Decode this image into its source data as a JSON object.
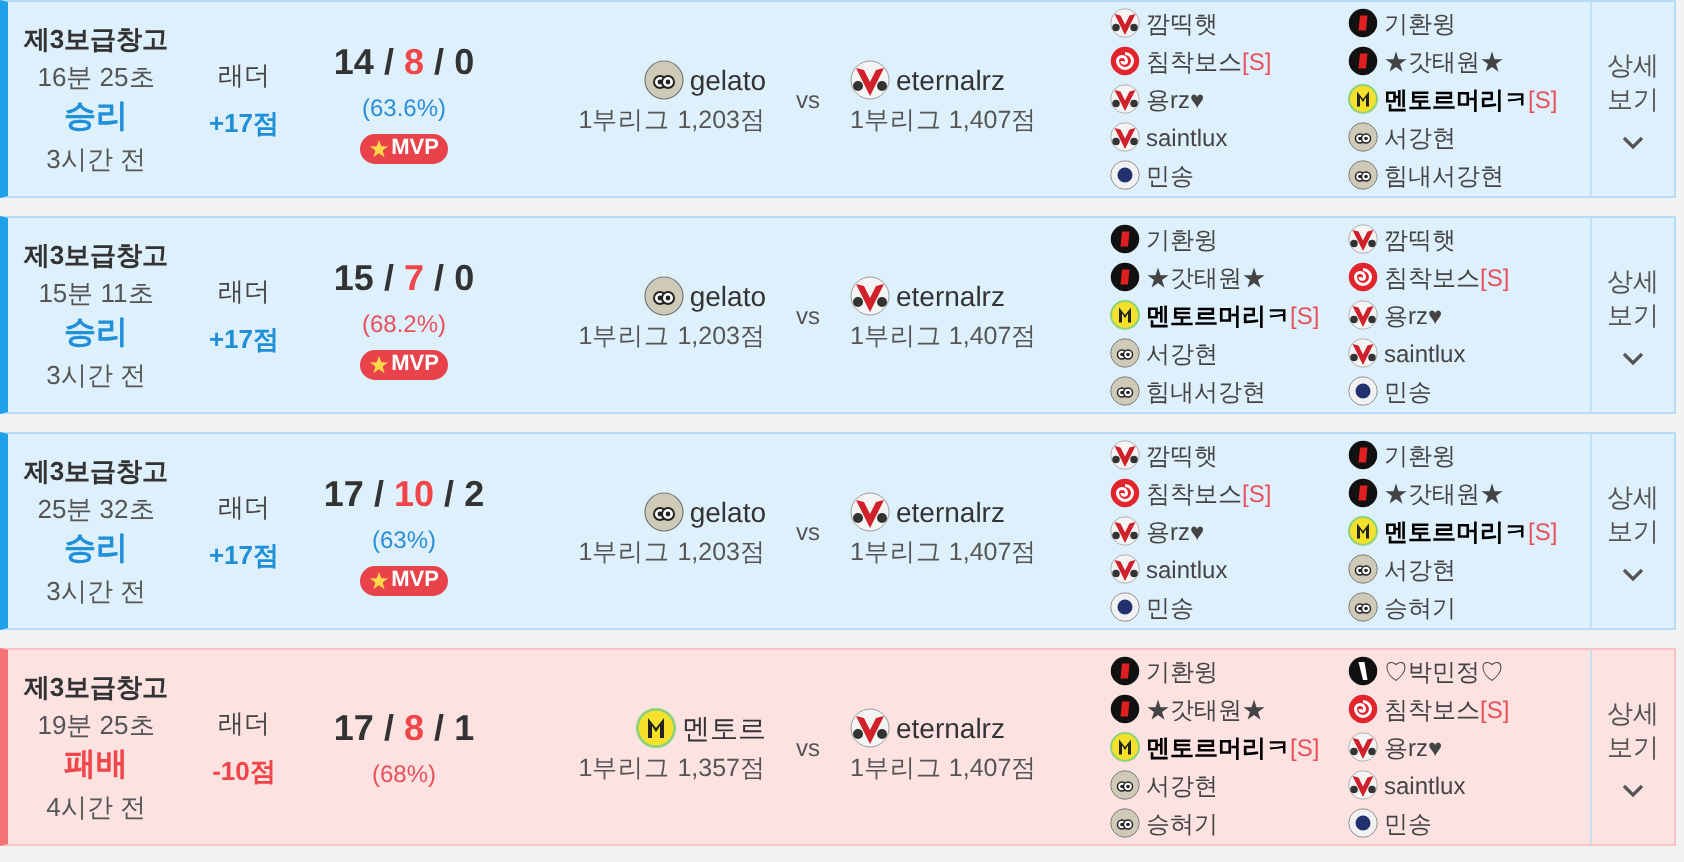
{
  "games": [
    {
      "win": true,
      "map": "제3보급창고",
      "duration": "16분 25초",
      "result": "승리",
      "ago": "3시간 전",
      "mode": "래더",
      "points": "+17점",
      "kills": "14",
      "deaths": "8",
      "assists": "0",
      "sep": "/",
      "percent": "(63.6%)",
      "color": "#2a8fd6",
      "badge": {
        "label": "MVP"
      },
      "player": {
        "kind": "cloud",
        "name": "gelato",
        "rank": "1부리그 1,203점"
      },
      "vs": "vs",
      "opponent": {
        "kind": "vee",
        "name": "eternalrz",
        "rank": "1부리그 1,407점"
      },
      "team_a": [
        {
          "kind": "vee",
          "name": "깜띡햇",
          "me": false
        },
        {
          "kind": "swirl",
          "name": "침착보스",
          "tag": "[S]",
          "me": false
        },
        {
          "kind": "vee",
          "name": "용rz♥",
          "me": false
        },
        {
          "kind": "vee",
          "name": "saintlux",
          "me": false
        },
        {
          "kind": "star",
          "name": "민송",
          "me": false
        }
      ],
      "team_b": [
        {
          "kind": "stripe",
          "name": "기환윙",
          "me": false
        },
        {
          "kind": "stripe",
          "name": "★갓태원★",
          "me": false
        },
        {
          "kind": "m",
          "name": "멘토르머리ㅋ",
          "tag": "[S]",
          "me": true
        },
        {
          "kind": "cloud",
          "name": "서강현",
          "me": false
        },
        {
          "kind": "cloud",
          "name": "힘내서강현",
          "me": false
        }
      ],
      "details": "상세 보기"
    },
    {
      "win": true,
      "map": "제3보급창고",
      "duration": "15분 11초",
      "result": "승리",
      "ago": "3시간 전",
      "mode": "래더",
      "points": "+17점",
      "kills": "15",
      "deaths": "7",
      "assists": "0",
      "sep": "/",
      "percent": "(68.2%)",
      "color": "#e8505b",
      "badge": {
        "label": "MVP"
      },
      "player": {
        "kind": "cloud",
        "name": "gelato",
        "rank": "1부리그 1,203점"
      },
      "vs": "vs",
      "opponent": {
        "kind": "vee",
        "name": "eternalrz",
        "rank": "1부리그 1,407점"
      },
      "team_a": [
        {
          "kind": "stripe",
          "name": "기환윙",
          "me": false
        },
        {
          "kind": "stripe",
          "name": "★갓태원★",
          "me": false
        },
        {
          "kind": "m",
          "name": "멘토르머리ㅋ",
          "tag": "[S]",
          "me": true
        },
        {
          "kind": "cloud",
          "name": "서강현",
          "me": false
        },
        {
          "kind": "cloud",
          "name": "힘내서강현",
          "me": false
        }
      ],
      "team_b": [
        {
          "kind": "vee",
          "name": "깜띡햇",
          "me": false
        },
        {
          "kind": "swirl",
          "name": "침착보스",
          "tag": "[S]",
          "me": false
        },
        {
          "kind": "vee",
          "name": "용rz♥",
          "me": false
        },
        {
          "kind": "vee",
          "name": "saintlux",
          "me": false
        },
        {
          "kind": "star",
          "name": "민송",
          "me": false
        }
      ],
      "details": "상세 보기"
    },
    {
      "win": true,
      "map": "제3보급창고",
      "duration": "25분 32초",
      "result": "승리",
      "ago": "3시간 전",
      "mode": "래더",
      "points": "+17점",
      "kills": "17",
      "deaths": "10",
      "assists": "2",
      "sep": "/",
      "percent": "(63%)",
      "color": "#2a8fd6",
      "badge": {
        "label": "MVP"
      },
      "player": {
        "kind": "cloud",
        "name": "gelato",
        "rank": "1부리그 1,203점"
      },
      "vs": "vs",
      "opponent": {
        "kind": "vee",
        "name": "eternalrz",
        "rank": "1부리그 1,407점"
      },
      "team_a": [
        {
          "kind": "vee",
          "name": "깜띡햇",
          "me": false
        },
        {
          "kind": "swirl",
          "name": "침착보스",
          "tag": "[S]",
          "me": false
        },
        {
          "kind": "vee",
          "name": "용rz♥",
          "me": false
        },
        {
          "kind": "vee",
          "name": "saintlux",
          "me": false
        },
        {
          "kind": "star",
          "name": "민송",
          "me": false
        }
      ],
      "team_b": [
        {
          "kind": "stripe",
          "name": "기환윙",
          "me": false
        },
        {
          "kind": "stripe",
          "name": "★갓태원★",
          "me": false
        },
        {
          "kind": "m",
          "name": "멘토르머리ㅋ",
          "tag": "[S]",
          "me": true
        },
        {
          "kind": "cloud",
          "name": "서강현",
          "me": false
        },
        {
          "kind": "cloud",
          "name": "승혀기",
          "me": false
        }
      ],
      "details": "상세 보기"
    },
    {
      "win": false,
      "map": "제3보급창고",
      "duration": "19분 25초",
      "result": "패배",
      "ago": "4시간 전",
      "mode": "래더",
      "points": "-10점",
      "kills": "17",
      "deaths": "8",
      "assists": "1",
      "sep": "/",
      "percent": "(68%)",
      "color": "#e8505b",
      "player": {
        "kind": "m",
        "name": "멘토르",
        "rank": "1부리그 1,357점"
      },
      "vs": "vs",
      "opponent": {
        "kind": "vee",
        "name": "eternalrz",
        "rank": "1부리그 1,407점"
      },
      "team_a": [
        {
          "kind": "stripe",
          "name": "기환윙",
          "me": false
        },
        {
          "kind": "stripe",
          "name": "★갓태원★",
          "me": false
        },
        {
          "kind": "m",
          "name": "멘토르머리ㅋ",
          "tag": "[S]",
          "me": true
        },
        {
          "kind": "cloud",
          "name": "서강현",
          "me": false
        },
        {
          "kind": "cloud",
          "name": "승혀기",
          "me": false
        }
      ],
      "team_b": [
        {
          "kind": "slash",
          "name": "♡박민정♡",
          "me": false
        },
        {
          "kind": "swirl",
          "name": "침착보스",
          "tag": "[S]",
          "me": false
        },
        {
          "kind": "vee",
          "name": "용rz♥",
          "me": false
        },
        {
          "kind": "vee",
          "name": "saintlux",
          "me": false
        },
        {
          "kind": "star",
          "name": "민송",
          "me": false
        }
      ],
      "details": "상세 보기"
    }
  ]
}
